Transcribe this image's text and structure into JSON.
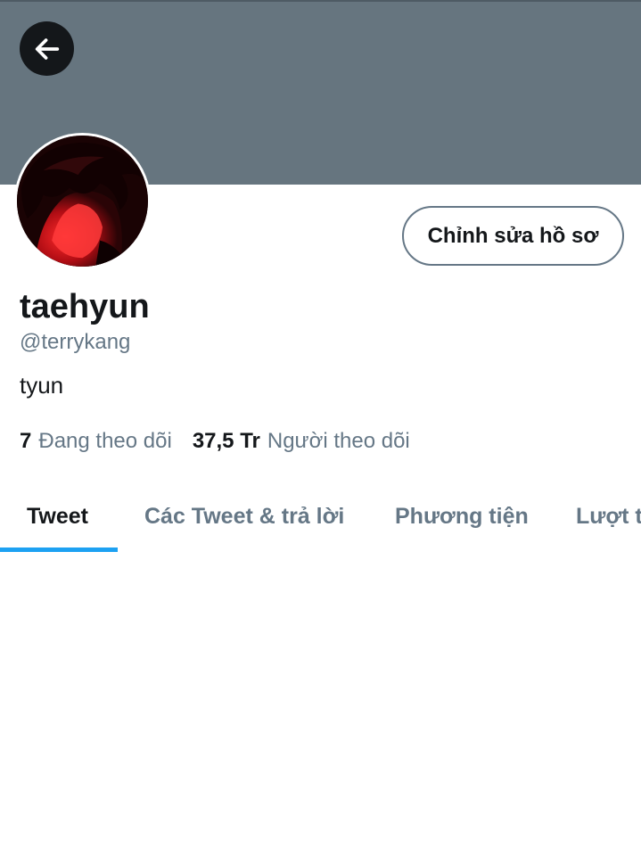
{
  "profile": {
    "display_name": "taehyun",
    "handle": "@terrykang",
    "bio": "tyun",
    "edit_button_label": "Chỉnh sửa hồ sơ"
  },
  "stats": {
    "following_count": "7",
    "following_label": "Đang theo dõi",
    "followers_count": "37,5 Tr",
    "followers_label": "Người theo dõi"
  },
  "tabs": [
    {
      "label": "Tweet",
      "active": true
    },
    {
      "label": "Các Tweet & trả lời",
      "active": false
    },
    {
      "label": "Phương tiện",
      "active": false
    },
    {
      "label": "Lượt thích",
      "active": false
    }
  ],
  "icons": {
    "back": "arrow-left-icon"
  },
  "colors": {
    "banner": "#66757f",
    "accent": "#1da1f2",
    "primary_text": "#14171a",
    "secondary_text": "#657786"
  }
}
